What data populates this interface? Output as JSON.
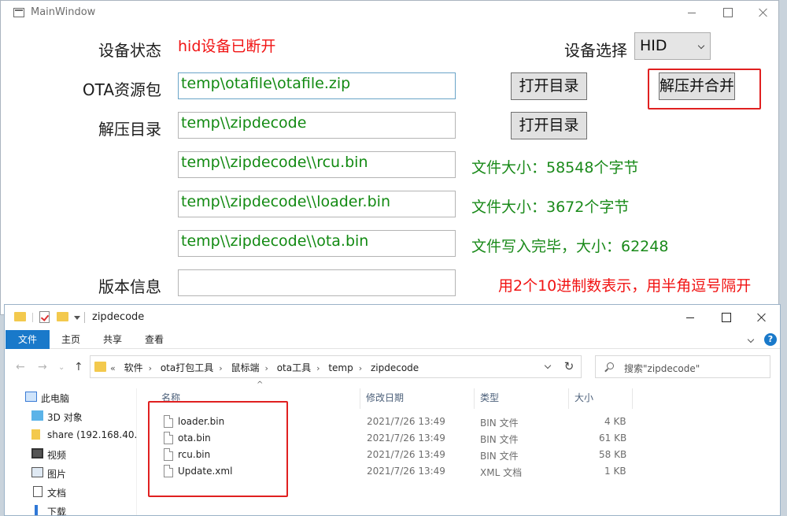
{
  "main_window": {
    "title": "MainWindow",
    "device_status_label": "设备状态",
    "device_status_value": "hid设备已断开",
    "device_select_label": "设备选择",
    "device_select_value": "HID",
    "ota_label": "OTA资源包",
    "ota_path": "temp\\otafile\\otafile.zip",
    "open_dir_label": "打开目录",
    "unzip_merge_label": "解压并合并",
    "unzip_dir_label": "解压目录",
    "unzip_dir_path": "temp\\\\zipdecode",
    "open_dir2_label": "打开目录",
    "rcu_path": "temp\\\\zipdecode\\\\rcu.bin",
    "rcu_info": "文件大小：58548个字节",
    "loader_path": "temp\\\\zipdecode\\\\loader.bin",
    "loader_info": "文件大小：3672个字节",
    "ota_bin_path": "temp\\\\zipdecode\\\\ota.bin",
    "ota_bin_info": "文件写入完毕，大小：62248",
    "version_label": "版本信息",
    "version_value": "",
    "version_hint": "用2个10进制数表示，用半角逗号隔开"
  },
  "explorer": {
    "title": "zipdecode",
    "ribbon_tabs": [
      "文件",
      "主页",
      "共享",
      "查看"
    ],
    "breadcrumb": [
      "«",
      "软件",
      "ota打包工具",
      "鼠标端",
      "ota工具",
      "temp",
      "zipdecode"
    ],
    "search_placeholder": "搜索\"zipdecode\"",
    "sidebar": [
      {
        "label": "此电脑",
        "icon": "computer-icon"
      },
      {
        "label": "3D 对象",
        "icon": "cube-icon"
      },
      {
        "label": "share (192.168.40.",
        "icon": "network-drive-icon"
      },
      {
        "label": "视频",
        "icon": "video-icon"
      },
      {
        "label": "图片",
        "icon": "picture-icon"
      },
      {
        "label": "文档",
        "icon": "document-icon"
      },
      {
        "label": "下载",
        "icon": "download-icon"
      }
    ],
    "columns": [
      "名称",
      "修改日期",
      "类型",
      "大小"
    ],
    "files": [
      {
        "name": "loader.bin",
        "date": "2021/7/26 13:49",
        "type": "BIN 文件",
        "size": "4 KB"
      },
      {
        "name": "ota.bin",
        "date": "2021/7/26 13:49",
        "type": "BIN 文件",
        "size": "61 KB"
      },
      {
        "name": "rcu.bin",
        "date": "2021/7/26 13:49",
        "type": "BIN 文件",
        "size": "58 KB"
      },
      {
        "name": "Update.xml",
        "date": "2021/7/26 13:49",
        "type": "XML 文档",
        "size": "1 KB"
      }
    ]
  }
}
